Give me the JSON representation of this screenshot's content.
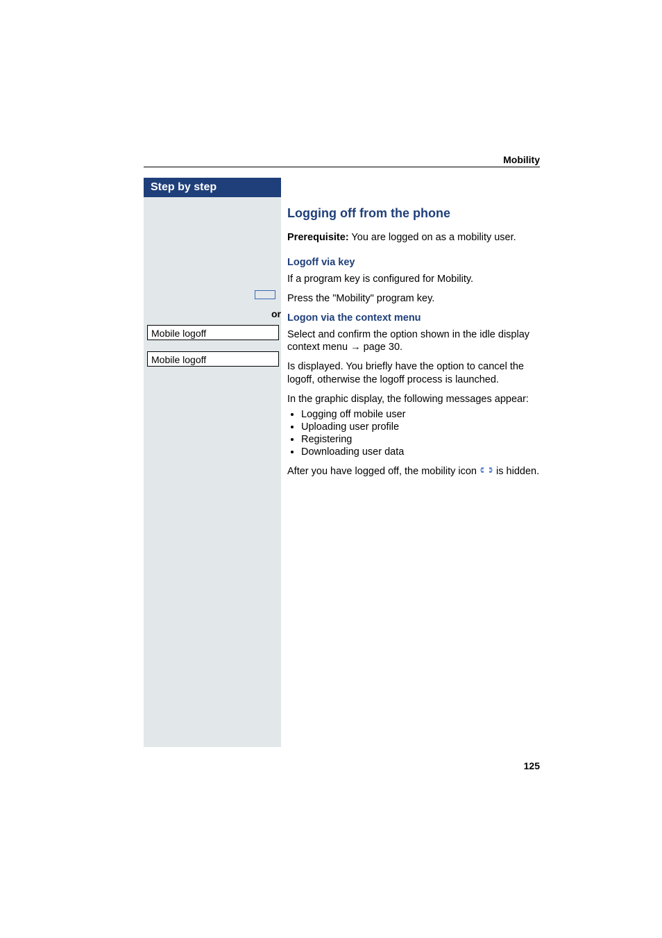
{
  "header": {
    "section": "Mobility"
  },
  "sidebar": {
    "title": "Step by step",
    "menu_option_1": "Mobile logoff",
    "menu_option_2": "Mobile logoff",
    "or_label": "or"
  },
  "content": {
    "heading": "Logging off from the phone",
    "prereq_label": "Prerequisite:",
    "prereq_text": " You are logged on as a mobility user.",
    "sub1": "Logoff via key",
    "sub1_text": "If a program key is configured for Mobility.",
    "press_key": "Press the \"Mobility\" program key.",
    "sub2": "Logon via the context menu",
    "select_confirm": "Select and confirm the option shown in the idle display context menu ",
    "page_ref": " page 30.",
    "is_displayed": "Is displayed. You briefly have the option to cancel the logoff, otherwise the logoff process is launched.",
    "graphic_intro": "In the graphic display, the following messages appear:",
    "bullets": [
      "Logging off mobile user",
      "Uploading user profile",
      "Registering",
      "Downloading user data"
    ],
    "after_logoff_pre": "After you have logged off, the mobility icon ",
    "after_logoff_post": " is hidden."
  },
  "page_number": "125"
}
